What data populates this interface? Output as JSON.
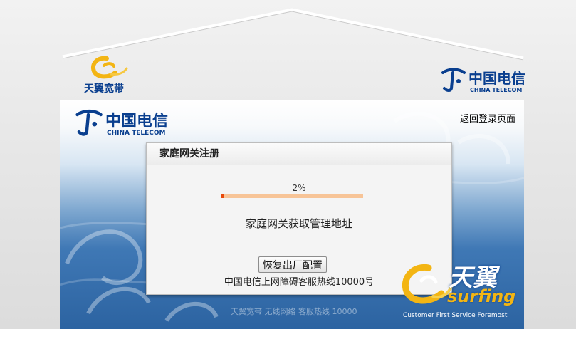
{
  "brand": {
    "broadband_name": "天翼宽带",
    "telecom_cn": "中国电信",
    "telecom_en": "CHINA TELECOM"
  },
  "nav": {
    "back_login": "返回登录页面"
  },
  "dialog": {
    "title": "家庭网关注册",
    "progress_text": "2%",
    "progress_value": 2,
    "status": "家庭网关获取管理地址",
    "reset_button": "恢复出厂配置",
    "hotline": "中国电信上网障碍客服热线10000号"
  },
  "footer": {
    "faint_text": "天翼宽带 无线网络 客服热线 10000",
    "surfing_cn": "天翼",
    "surfing_en": "surfing",
    "slogan": "Customer First Service Foremost"
  },
  "colors": {
    "progress_fill": "#e84a0c",
    "progress_track": "#f7c497",
    "telecom_blue": "#0a3f8f",
    "surfing_gold": "#f3b513"
  }
}
